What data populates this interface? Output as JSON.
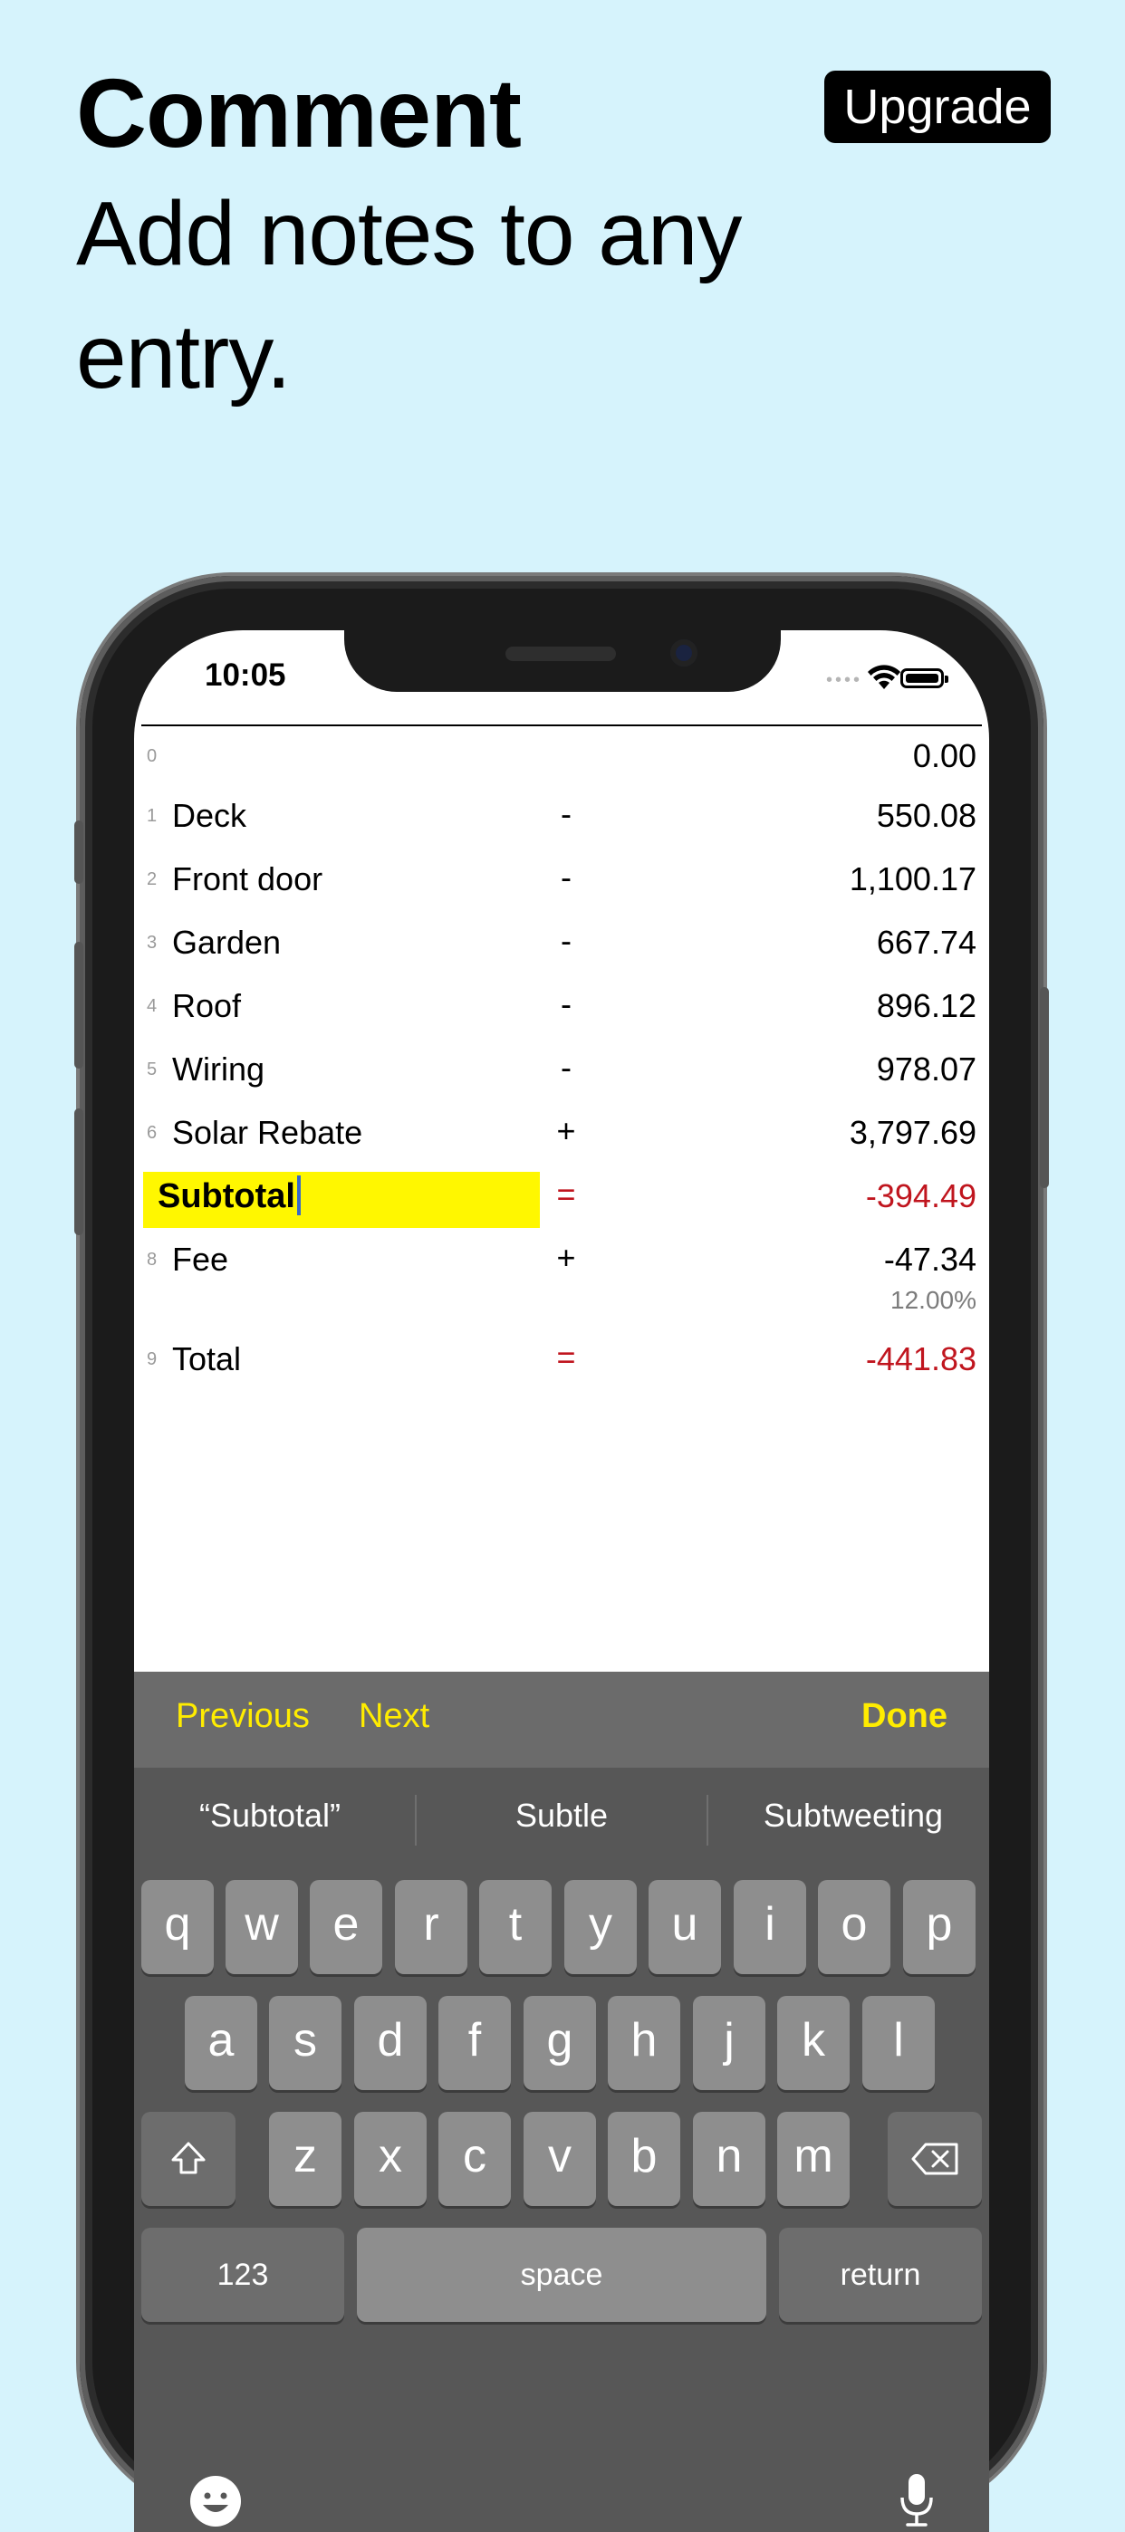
{
  "headline": {
    "title": "Comment",
    "subtitle": "Add notes to any entry.",
    "upgrade_label": "Upgrade"
  },
  "status": {
    "time": "10:05"
  },
  "rows": [
    {
      "num": "0",
      "label": "",
      "op": "",
      "value": "0.00"
    },
    {
      "num": "1",
      "label": "Deck",
      "op": "-",
      "value": "550.08"
    },
    {
      "num": "2",
      "label": "Front door",
      "op": "-",
      "value": "1,100.17"
    },
    {
      "num": "3",
      "label": "Garden",
      "op": "-",
      "value": "667.74"
    },
    {
      "num": "4",
      "label": "Roof",
      "op": "-",
      "value": "896.12"
    },
    {
      "num": "5",
      "label": "Wiring",
      "op": "-",
      "value": "978.07"
    },
    {
      "num": "6",
      "label": "Solar Rebate",
      "op": "+",
      "value": "3,797.69"
    },
    {
      "num": "",
      "label": "Subtotal",
      "op": "=",
      "value": "-394.49",
      "editing": true
    },
    {
      "num": "8",
      "label": "Fee",
      "op": "+",
      "value": "-47.34",
      "sub": "12.00%"
    },
    {
      "num": "9",
      "label": "Total",
      "op": "=",
      "value": "-441.83"
    }
  ],
  "accessory": {
    "previous": "Previous",
    "next": "Next",
    "done": "Done"
  },
  "suggestions": [
    "“Subtotal”",
    "Subtle",
    "Subtweeting"
  ],
  "keyboard": {
    "row1": [
      "q",
      "w",
      "e",
      "r",
      "t",
      "y",
      "u",
      "i",
      "o",
      "p"
    ],
    "row2": [
      "a",
      "s",
      "d",
      "f",
      "g",
      "h",
      "j",
      "k",
      "l"
    ],
    "row3": [
      "z",
      "x",
      "c",
      "v",
      "b",
      "n",
      "m"
    ],
    "numbers_label": "123",
    "space_label": "space",
    "return_label": "return"
  },
  "colors": {
    "accent_yellow": "#ffec00",
    "negative_red": "#c0151e",
    "highlight": "#fff700"
  }
}
